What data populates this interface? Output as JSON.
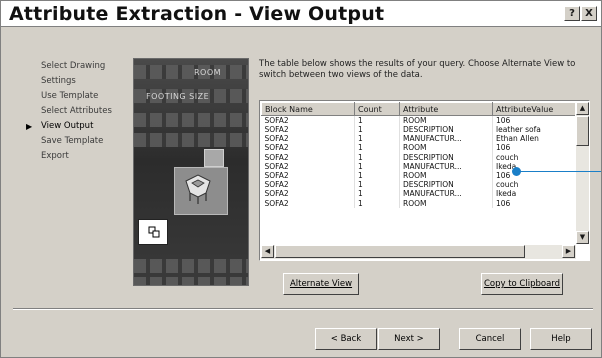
{
  "window": {
    "title": "Attribute Extraction - View Output",
    "help_label": "?",
    "close_label": "X"
  },
  "steps": [
    {
      "label": "Select Drawing",
      "current": false
    },
    {
      "label": "Settings",
      "current": false
    },
    {
      "label": "Use Template",
      "current": false
    },
    {
      "label": "Select Attributes",
      "current": false
    },
    {
      "label": "View Output",
      "current": true
    },
    {
      "label": "Save Template",
      "current": false
    },
    {
      "label": "Export",
      "current": false
    }
  ],
  "art": {
    "label_top": "ROOM",
    "label_mid": "FOOTING SIZE"
  },
  "description": "The table below shows the results of your query. Choose Alternate View to switch between two views of the data.",
  "table": {
    "columns": [
      "Block Name",
      "Count",
      "Attribute",
      "AttributeValue"
    ],
    "rows": [
      [
        "SOFA2",
        "1",
        "ROOM",
        "106"
      ],
      [
        "SOFA2",
        "1",
        "DESCRIPTION",
        "leather sofa"
      ],
      [
        "SOFA2",
        "1",
        "MANUFACTUR...",
        "Ethan Allen"
      ],
      [
        "SOFA2",
        "1",
        "ROOM",
        "106"
      ],
      [
        "SOFA2",
        "1",
        "DESCRIPTION",
        "couch"
      ],
      [
        "SOFA2",
        "1",
        "MANUFACTUR...",
        "Ikeda"
      ],
      [
        "SOFA2",
        "1",
        "ROOM",
        "106"
      ],
      [
        "SOFA2",
        "1",
        "DESCRIPTION",
        "couch"
      ],
      [
        "SOFA2",
        "1",
        "MANUFACTUR...",
        "Ikeda"
      ],
      [
        "SOFA2",
        "1",
        "ROOM",
        "106"
      ]
    ]
  },
  "buttons": {
    "alternate_view": "Alternate View",
    "copy_clipboard": "Copy to Clipboard",
    "back": "< Back",
    "next": "Next >",
    "cancel": "Cancel",
    "help": "Help"
  },
  "colors": {
    "callout": "#1a7fc8",
    "dialog_bg": "#d4d0c8"
  }
}
